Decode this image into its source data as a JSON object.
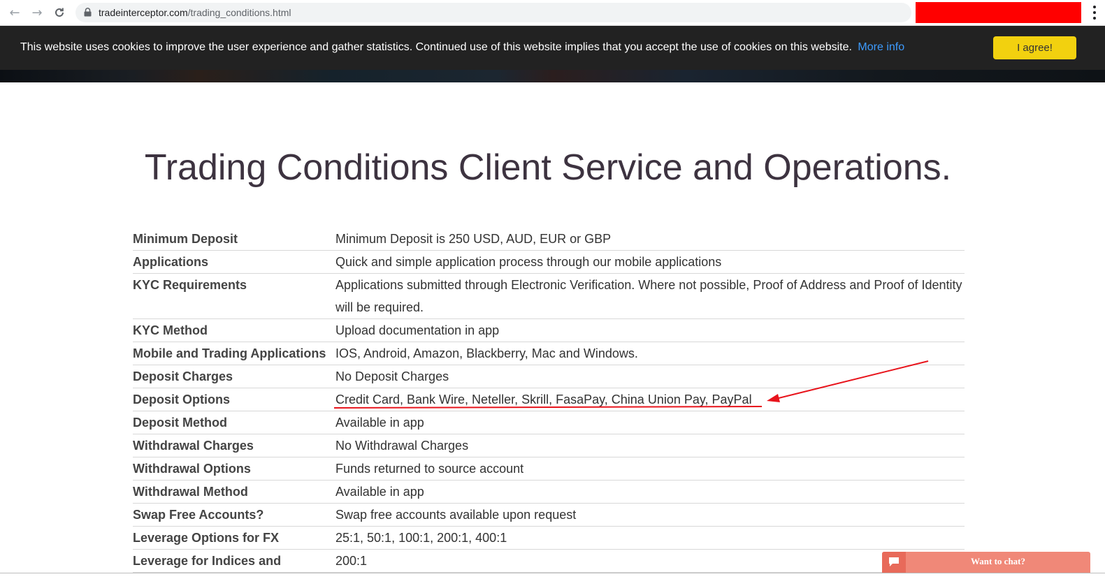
{
  "browser": {
    "url_host": "tradeinterceptor.com",
    "url_path": "/trading_conditions.html"
  },
  "cookie_bar": {
    "message": "This website uses cookies to improve the user experience and gather statistics. Continued use of this website implies that you accept the use of cookies on this website.",
    "link_label": "More info",
    "agree_label": "I agree!"
  },
  "page": {
    "title": "Trading Conditions Client Service and Operations."
  },
  "conditions": [
    {
      "label": "Minimum Deposit",
      "value": "Minimum Deposit is 250 USD, AUD, EUR or GBP"
    },
    {
      "label": "Applications",
      "value": "Quick and simple application process through our mobile applications"
    },
    {
      "label": "KYC Requirements",
      "value": "Applications submitted through Electronic Verification. Where not possible, Proof of Address and Proof of Identity will be required."
    },
    {
      "label": "KYC Method",
      "value": "Upload documentation in app"
    },
    {
      "label": "Mobile and Trading Applications",
      "value": "IOS, Android, Amazon, Blackberry, Mac and Windows."
    },
    {
      "label": "Deposit Charges",
      "value": "No Deposit Charges"
    },
    {
      "label": "Deposit Options",
      "value": "Credit Card, Bank Wire, Neteller, Skrill, FasaPay, China Union Pay, PayPal"
    },
    {
      "label": "Deposit Method",
      "value": "Available in app"
    },
    {
      "label": "Withdrawal Charges",
      "value": "No Withdrawal Charges"
    },
    {
      "label": "Withdrawal Options",
      "value": "Funds returned to source account"
    },
    {
      "label": "Withdrawal Method",
      "value": "Available in app"
    },
    {
      "label": "Swap Free Accounts?",
      "value": "Swap free accounts available upon request"
    },
    {
      "label": "Leverage Options for FX",
      "value": "25:1, 50:1, 100:1, 200:1, 400:1"
    },
    {
      "label": "Leverage for Indices and",
      "value": "200:1"
    }
  ],
  "chat": {
    "label": "Want to chat?"
  },
  "colors": {
    "annotation": "#e8141c",
    "cookie_bar": "#222222",
    "agree_button": "#f2d10f",
    "chat_widget": "#f08878",
    "title_text": "#3d3340"
  },
  "icons": {
    "back": "arrow-left",
    "forward": "arrow-right",
    "reload": "reload",
    "lock": "lock",
    "menu": "kebab",
    "chat": "speech-bubble"
  }
}
